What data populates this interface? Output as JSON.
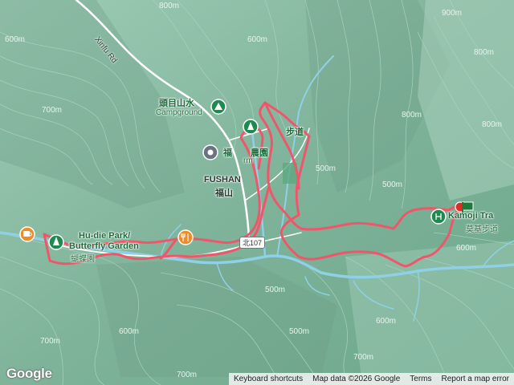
{
  "labels": {
    "road_xinfu": "Xinfu Rd",
    "campground_zh": "頭目山水",
    "campground_en": "Campground",
    "fushan_partial_zh": "福",
    "farm_zh": "農園",
    "farm_partial_en": "rm",
    "trail_top_zh": "步道",
    "fushan_en": "FUSHAN",
    "fushan_zh": "福山",
    "hudie_en": "Hu-die Park/",
    "butterfly_en": "Butterfly Garden",
    "hudie_zh": "蝴蝶園",
    "kamoji_en": "Kamoji Tra",
    "kamoji_zh": "莫基步道",
    "route_shield": "北107"
  },
  "contour_labels": [
    "900m",
    "800m",
    "600m",
    "600m",
    "700m",
    "800m",
    "800m",
    "500m",
    "500m",
    "500m",
    "700m",
    "700m",
    "600m",
    "600m",
    "800m",
    "500m",
    "600m",
    "700m"
  ],
  "footer": {
    "google": "Google",
    "keyboard": "Keyboard shortcuts",
    "map_data": "Map data ©2026 Google",
    "terms": "Terms",
    "report": "Report a map error"
  },
  "colors": {
    "terrain": "#7fb39a",
    "contour": "#a9d2bf",
    "river": "#8ed0e6",
    "road": "#ffffff",
    "track": "#f0566a",
    "poi_green": "#1e8a4f",
    "restaurant_orange": "#f08b27",
    "cafe_orange": "#f08b27",
    "start_flag": "#1e7a3c",
    "end_pin": "#d93025"
  },
  "icons": [
    "campground-icon",
    "park-icon",
    "restaurant-icon",
    "cafe-icon",
    "place-pin-icon",
    "start-flag-icon",
    "trail-icon"
  ]
}
